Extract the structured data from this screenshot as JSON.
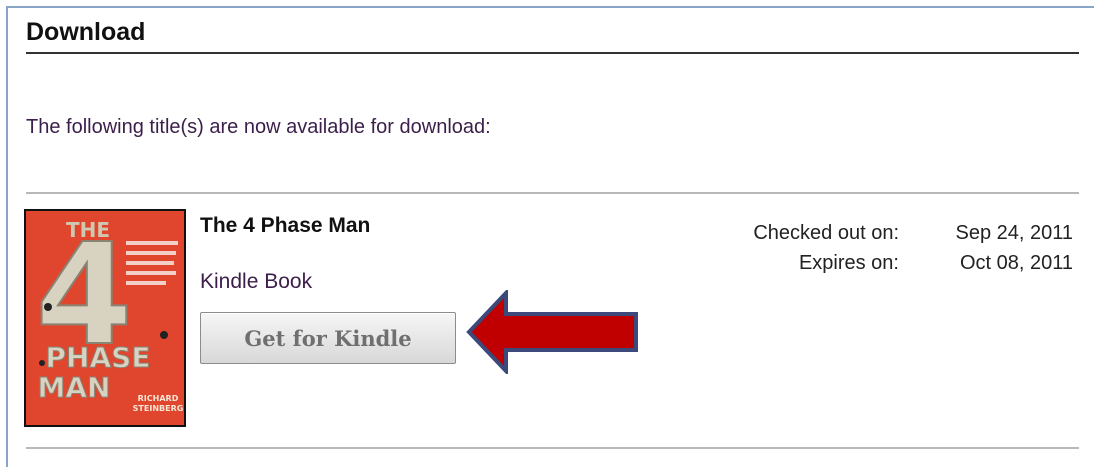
{
  "heading": "Download",
  "intro": "The following title(s) are now available for download:",
  "item": {
    "title": "The 4 Phase Man",
    "format": "Kindle Book",
    "button_label": "Get for Kindle",
    "checked_out_label": "Checked out on:",
    "checked_out_date": "Sep 24, 2011",
    "expires_label": "Expires on:",
    "expires_date": "Oct 08, 2011",
    "cover": {
      "title_top": "THE",
      "title_number": "4",
      "title_line2": "PHASE",
      "title_line3": "MAN",
      "author_first": "RICHARD",
      "author_last": "STEINBERG",
      "background_color": "#e0452e"
    }
  },
  "arrow": {
    "color": "#c00000",
    "outline": "#3b4a7a"
  }
}
